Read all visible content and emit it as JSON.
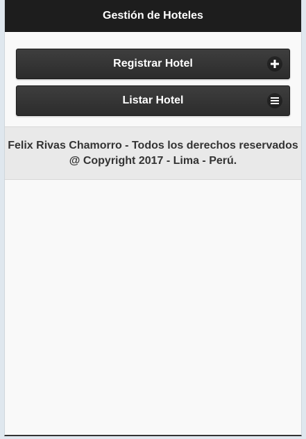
{
  "header": {
    "title": "Gestión de Hoteles"
  },
  "buttons": {
    "register": {
      "label": "Registrar Hotel",
      "icon": "plus-icon"
    },
    "list": {
      "label": "Listar Hotel",
      "icon": "bars-icon"
    }
  },
  "footer": {
    "line1": "Felix Rivas Chamorro - Todos los derechos reservados",
    "line2": "@ Copyright 2017 - Lima - Perú."
  },
  "colors": {
    "header_bg": "#1d1d1d",
    "button_bg": "#333333",
    "page_bg": "#f9f9f9",
    "footer_bg": "#e9e9e9"
  }
}
